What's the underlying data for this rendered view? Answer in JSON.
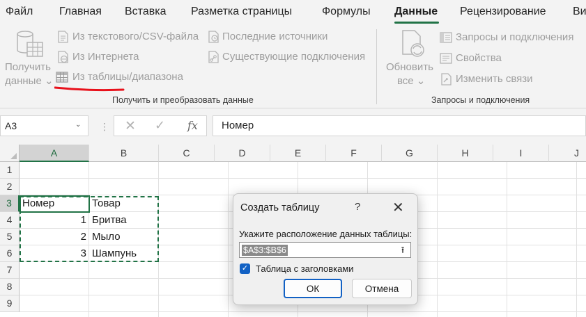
{
  "tabs": [
    "Файл",
    "Главная",
    "Вставка",
    "Разметка страницы",
    "Формулы",
    "Данные",
    "Рецензирование",
    "Ви"
  ],
  "active_tab": "Данные",
  "ribbon": {
    "get_data": {
      "line1": "Получить",
      "line2": "данные ⌄"
    },
    "from_text_csv": "Из текстового/CSV-файла",
    "from_web": "Из Интернета",
    "from_table": "Из таблицы/диапазона",
    "recent_sources": "Последние источники",
    "existing_connections": "Существующие подключения",
    "group1_label": "Получить и преобразовать данные",
    "refresh_all": {
      "line1": "Обновить",
      "line2": "все ⌄"
    },
    "queries_connections": "Запросы и подключения",
    "properties": "Свойства",
    "edit_links": "Изменить связи",
    "group2_label": "Запросы и подключения",
    "highlight_color": "#e8111b"
  },
  "formula_bar": {
    "name_box": "A3",
    "name_box_arrow": "⌄",
    "dots": "⋮",
    "cancel_symbol": "✕",
    "enter_symbol": "✓",
    "fx_symbol": "fx",
    "formula": "Номер"
  },
  "sheet": {
    "columns": [
      "A",
      "B",
      "C",
      "D",
      "E",
      "F",
      "G",
      "H",
      "I",
      "J"
    ],
    "rows": [
      "1",
      "2",
      "3",
      "4",
      "5",
      "6",
      "7",
      "8",
      "9"
    ],
    "cells": [
      {
        "ref": "A3",
        "value": "Номер",
        "align": "left"
      },
      {
        "ref": "B3",
        "value": "Товар",
        "align": "left"
      },
      {
        "ref": "A4",
        "value": "1",
        "align": "right"
      },
      {
        "ref": "B4",
        "value": "Бритва",
        "align": "left"
      },
      {
        "ref": "A5",
        "value": "2",
        "align": "right"
      },
      {
        "ref": "B5",
        "value": "Мыло",
        "align": "left"
      },
      {
        "ref": "A6",
        "value": "3",
        "align": "right"
      },
      {
        "ref": "B6",
        "value": "Шампунь",
        "align": "left"
      }
    ],
    "active_cell": "A3",
    "selected_range": "A3:B6"
  },
  "dialog": {
    "title": "Создать таблицу",
    "help": "?",
    "close": "✕",
    "prompt": "Укажите расположение данных таблицы:",
    "range_value": "$A$3:$B$6",
    "collapse_symbol": "⭱",
    "has_headers_checked": true,
    "check_mark": "✓",
    "has_headers_label": "Таблица с заголовками",
    "ok_label": "ОК",
    "cancel_label": "Отмена"
  },
  "colors": {
    "excel_green": "#217346",
    "accent_blue": "#1261c4"
  }
}
